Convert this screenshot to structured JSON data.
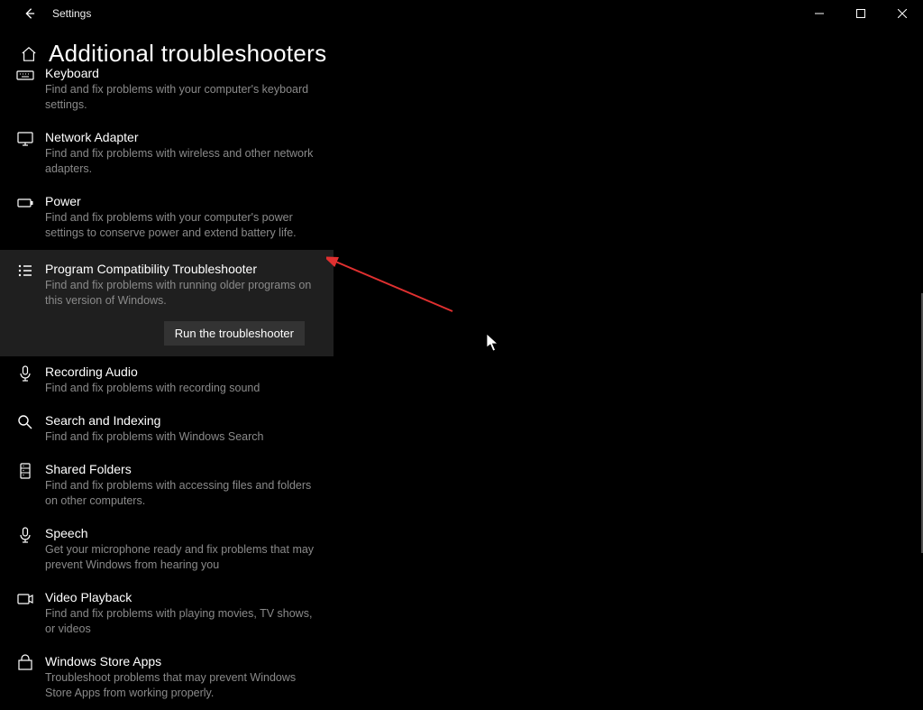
{
  "window": {
    "title": "Settings"
  },
  "header": {
    "title": "Additional troubleshooters"
  },
  "selected_action": {
    "run_button": "Run the troubleshooter"
  },
  "items": [
    {
      "title": "Keyboard",
      "desc": "Find and fix problems with your computer's keyboard settings."
    },
    {
      "title": "Network Adapter",
      "desc": "Find and fix problems with wireless and other network adapters."
    },
    {
      "title": "Power",
      "desc": "Find and fix problems with your computer's power settings to conserve power and extend battery life."
    },
    {
      "title": "Program Compatibility Troubleshooter",
      "desc": "Find and fix problems with running older programs on this version of Windows."
    },
    {
      "title": "Recording Audio",
      "desc": "Find and fix problems with recording sound"
    },
    {
      "title": "Search and Indexing",
      "desc": "Find and fix problems with Windows Search"
    },
    {
      "title": "Shared Folders",
      "desc": "Find and fix problems with accessing files and folders on other computers."
    },
    {
      "title": "Speech",
      "desc": "Get your microphone ready and fix problems that may prevent Windows from hearing you"
    },
    {
      "title": "Video Playback",
      "desc": "Find and fix problems with playing movies, TV shows, or videos"
    },
    {
      "title": "Windows Store Apps",
      "desc": "Troubleshoot problems that may prevent Windows Store Apps from working properly."
    }
  ]
}
